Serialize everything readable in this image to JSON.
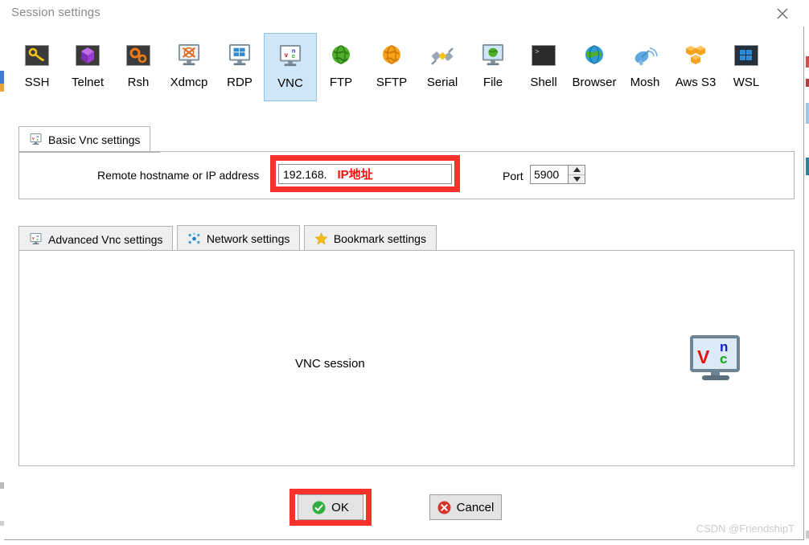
{
  "window": {
    "title": "Session settings",
    "close_label": "close-icon"
  },
  "protocols": [
    {
      "label": "SSH",
      "icon": "ssh-key-icon",
      "selected": false
    },
    {
      "label": "Telnet",
      "icon": "telnet-cube-icon",
      "selected": false
    },
    {
      "label": "Rsh",
      "icon": "rsh-gears-icon",
      "selected": false
    },
    {
      "label": "Xdmcp",
      "icon": "xdmcp-x-icon",
      "selected": false
    },
    {
      "label": "RDP",
      "icon": "rdp-windows-icon",
      "selected": false
    },
    {
      "label": "VNC",
      "icon": "vnc-monitor-icon",
      "selected": true
    },
    {
      "label": "FTP",
      "icon": "ftp-globe-icon",
      "selected": false
    },
    {
      "label": "SFTP",
      "icon": "sftp-globe-icon",
      "selected": false
    },
    {
      "label": "Serial",
      "icon": "serial-plug-icon",
      "selected": false
    },
    {
      "label": "File",
      "icon": "file-monitor-icon",
      "selected": false
    },
    {
      "label": "Shell",
      "icon": "shell-console-icon",
      "selected": false
    },
    {
      "label": "Browser",
      "icon": "browser-globe-icon",
      "selected": false
    },
    {
      "label": "Mosh",
      "icon": "mosh-dish-icon",
      "selected": false
    },
    {
      "label": "Aws S3",
      "icon": "aws-s3-cubes-icon",
      "selected": false
    },
    {
      "label": "WSL",
      "icon": "wsl-windows-icon",
      "selected": false
    }
  ],
  "basic_tab": {
    "label": "Basic Vnc settings",
    "icon": "vnc-monitor-icon"
  },
  "basic_form": {
    "host_label": "Remote hostname or IP address",
    "host_value": "192.168.",
    "host_annotation": "IP地址",
    "port_label": "Port",
    "port_value": "5900",
    "spinner_up": "▲",
    "spinner_down": "▼"
  },
  "settings_tabs": [
    {
      "label": "Advanced Vnc settings",
      "icon": "vnc-monitor-icon",
      "active": false
    },
    {
      "label": "Network settings",
      "icon": "network-nodes-icon",
      "active": false
    },
    {
      "label": "Bookmark settings",
      "icon": "star-icon",
      "active": false
    }
  ],
  "content_panel": {
    "caption": "VNC session",
    "logo": {
      "letter_v": "V",
      "letter_n": "n",
      "letter_c": "c",
      "name": "vnc-logo-icon"
    }
  },
  "buttons": {
    "ok": "OK",
    "cancel": "Cancel"
  },
  "watermark": "CSDN @FriendshipT",
  "colors": {
    "annotation_red": "#f8312a",
    "selected_tab_bg": "#cfe6f8",
    "selected_tab_border": "#8fc3e8",
    "panel_border": "#b4b4b4",
    "button_face": "#e3e3e3",
    "title_gray": "#8a8a8a",
    "ok_green": "#2fae3e",
    "cancel_red": "#d9342b"
  }
}
